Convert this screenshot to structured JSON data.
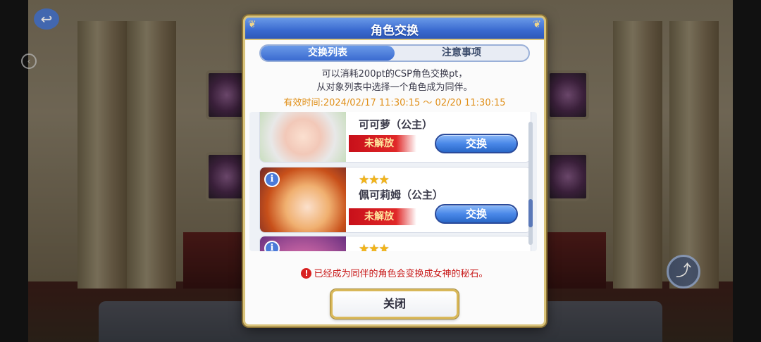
{
  "background": {
    "menu_title": "",
    "back_icon": "back-arrow-icon",
    "share_icon": "share-icon"
  },
  "dialog": {
    "title": "角色交换",
    "tabs": [
      {
        "label": "交换列表",
        "active": true
      },
      {
        "label": "注意事项",
        "active": false
      }
    ],
    "description_line1": "可以消耗200pt的CSP角色交换pt，",
    "description_line2": "从对象列表中选择一个角色成为同伴。",
    "period": "有效时间:2024/02/17  11:30:15 ～ 02/20  11:30:15",
    "characters": [
      {
        "name": "可可萝（公主）",
        "stars": "",
        "status": "未解放",
        "button": "交换"
      },
      {
        "name": "佩可莉姆（公主）",
        "stars": "★★★",
        "status": "未解放",
        "button": "交换"
      },
      {
        "name": "",
        "stars": "★★★",
        "status": "",
        "button": ""
      }
    ],
    "warning": "已经成为同伴的角色会变换成女神的秘石。",
    "close_label": "关闭"
  },
  "colors": {
    "header_blue": "#3a6ad0",
    "period_orange": "#e0901a",
    "locked_red": "#c8101a",
    "warning_red": "#c81818",
    "gold_border": "#d9c37a"
  }
}
